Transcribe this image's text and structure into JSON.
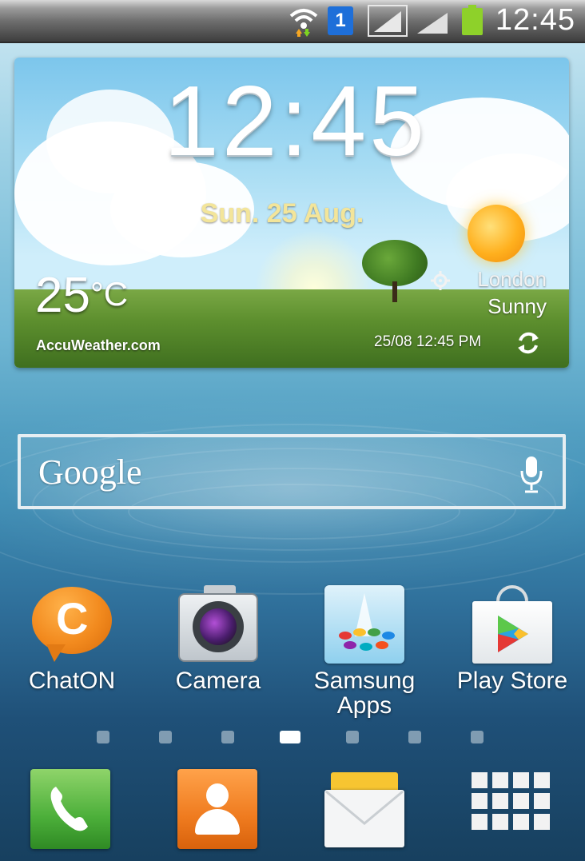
{
  "status_bar": {
    "time": "12:45",
    "sim_badge": "1",
    "icons": [
      "wifi-icon",
      "sim-icon",
      "signal-icon",
      "signal-icon",
      "battery-icon"
    ]
  },
  "weather": {
    "time": "12:45",
    "date": "Sun. 25 Aug.",
    "temperature": "25",
    "unit": "°C",
    "provider": "AccuWeather.com",
    "city": "London",
    "condition": "Sunny",
    "updated": "25/08 12:45 PM"
  },
  "search": {
    "logo": "Google"
  },
  "apps": [
    {
      "label": "ChatON",
      "icon": "chaton-icon"
    },
    {
      "label": "Camera",
      "icon": "camera-icon"
    },
    {
      "label": "Samsung Apps",
      "icon": "samsung-apps-icon"
    },
    {
      "label": "Play Store",
      "icon": "play-store-icon"
    }
  ],
  "page_indicator": {
    "count": 7,
    "active": 4
  },
  "dock": [
    {
      "icon": "phone-icon"
    },
    {
      "icon": "contacts-icon"
    },
    {
      "icon": "messages-icon"
    },
    {
      "icon": "apps-grid-icon"
    }
  ],
  "colors": {
    "date_text": "#f3e59a",
    "chaton_orange": "#f28a1e",
    "phone_green": "#4caf3a",
    "contacts_orange": "#ef7b1f"
  }
}
